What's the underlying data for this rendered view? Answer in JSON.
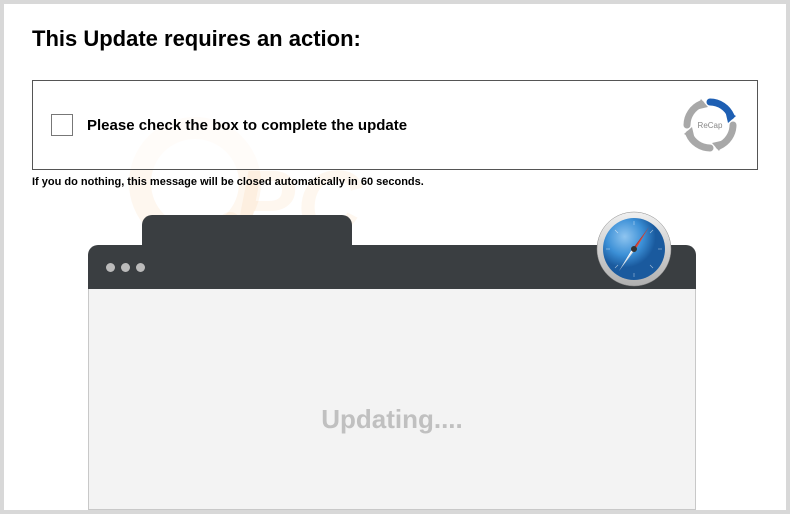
{
  "title": "This Update requires an action:",
  "action": {
    "checkbox_label": "Please check the box to complete the update",
    "recap_label": "ReCap"
  },
  "warning": "If you do nothing, this message will be closed automatically in 60 seconds.",
  "browser": {
    "status_text": "Updating...."
  },
  "watermark": "pcrisk.com"
}
